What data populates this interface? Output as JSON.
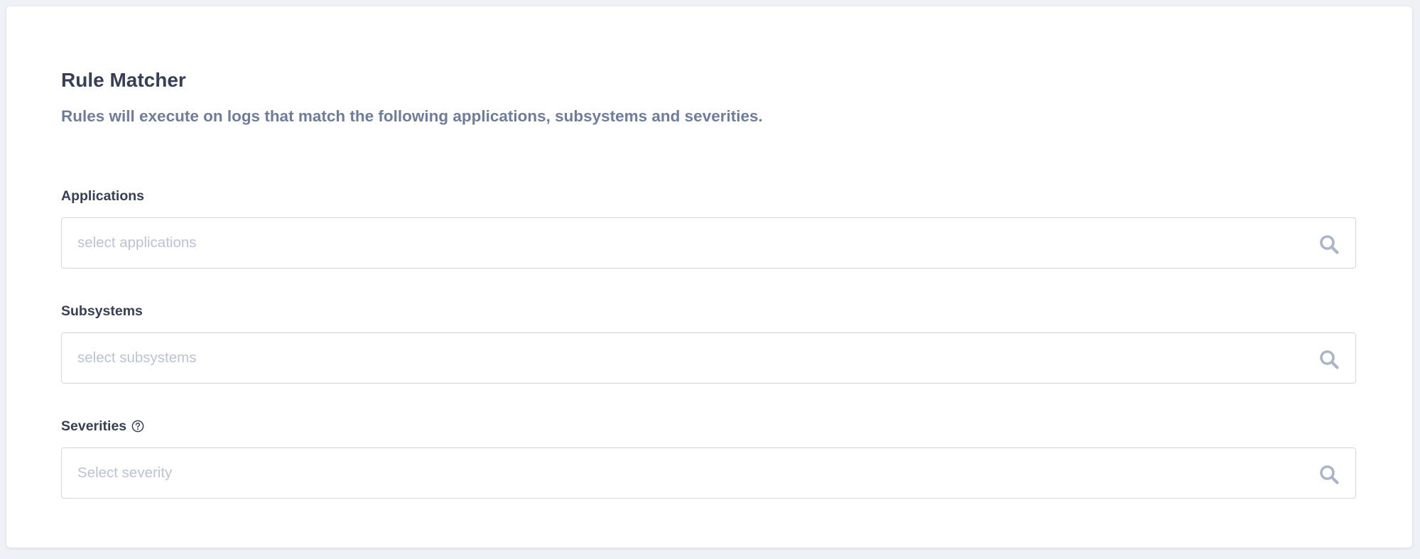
{
  "rule_matcher": {
    "title": "Rule Matcher",
    "description": "Rules will execute on logs that match the following applications, subsystems and severities."
  },
  "fields": {
    "applications": {
      "label": "Applications",
      "placeholder": "select applications",
      "value": "",
      "icon": "search-icon"
    },
    "subsystems": {
      "label": "Subsystems",
      "placeholder": "select subsystems",
      "value": "",
      "icon": "search-icon"
    },
    "severities": {
      "label": "Severities",
      "label_icon": "help-circle-icon",
      "placeholder": "Select severity",
      "value": "",
      "icon": "search-icon"
    }
  },
  "colors": {
    "page_background": "#eef1f6",
    "card_background": "#ffffff",
    "title_text": "#363f55",
    "description_text": "#6e7d9b",
    "placeholder_text": "#bac3d3",
    "input_border": "#d1d7e2",
    "icon": "#aab5c7"
  }
}
